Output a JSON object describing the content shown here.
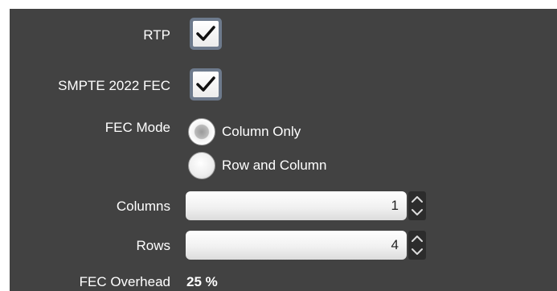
{
  "settings": {
    "rtp": {
      "label": "RTP",
      "checked": true
    },
    "smpte_fec": {
      "label": "SMPTE 2022 FEC",
      "checked": true
    },
    "fec_mode": {
      "label": "FEC Mode",
      "options": [
        {
          "label": "Column Only",
          "selected": true
        },
        {
          "label": "Row and Column",
          "selected": false
        }
      ]
    },
    "columns": {
      "label": "Columns",
      "value": "1"
    },
    "rows": {
      "label": "Rows",
      "value": "4"
    },
    "fec_overhead": {
      "label": "FEC Overhead",
      "value": "25 %"
    }
  },
  "colors": {
    "panel_bg": "#424242",
    "checkbox_frame": "#6d7a8c",
    "text": "#ffffff"
  },
  "icons": {
    "checkbox": "check-icon",
    "spinner_up": "chevron-up-icon",
    "spinner_down": "chevron-down-icon"
  }
}
